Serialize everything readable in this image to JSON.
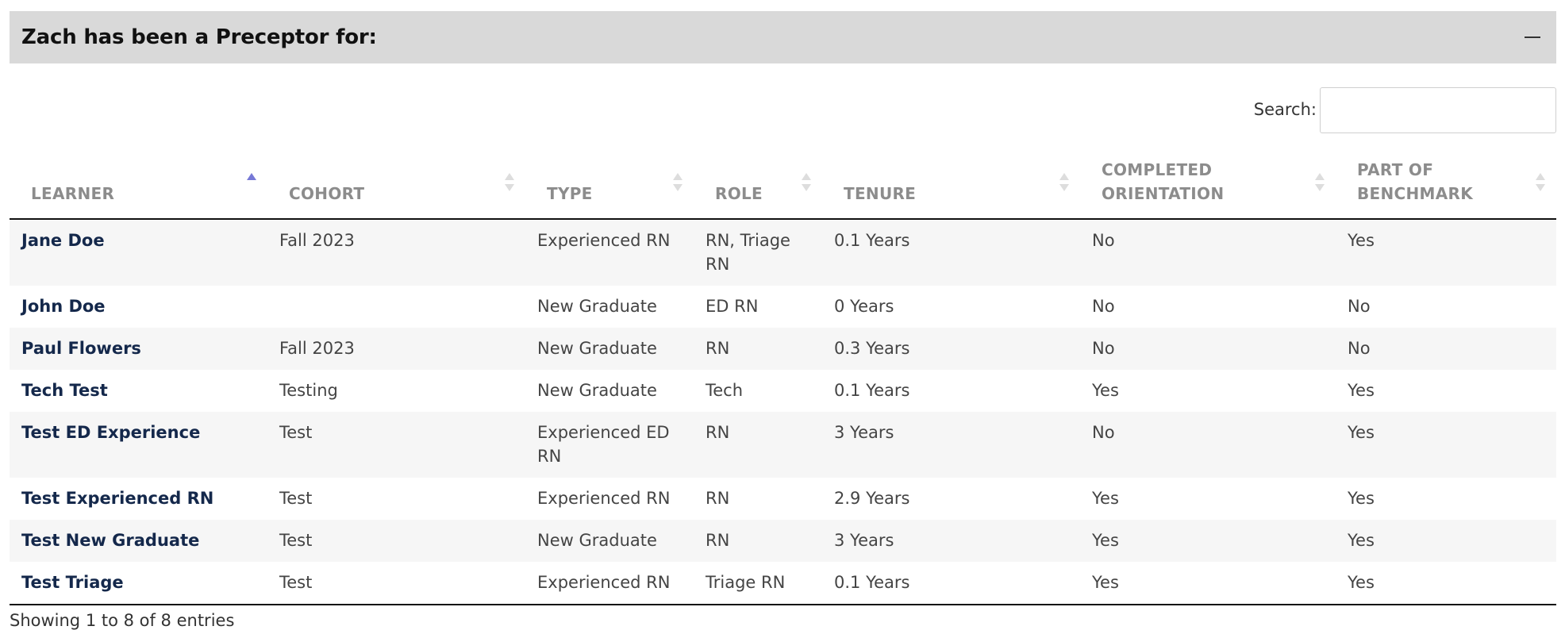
{
  "panel": {
    "title": "Zach has been a Preceptor for:",
    "collapse_icon": "minus-icon"
  },
  "search": {
    "label": "Search:",
    "value": "",
    "placeholder": ""
  },
  "table": {
    "columns": [
      {
        "label": "LEARNER",
        "sort": "asc"
      },
      {
        "label": "COHORT",
        "sort": "none"
      },
      {
        "label": "TYPE",
        "sort": "none"
      },
      {
        "label": "ROLE",
        "sort": "none"
      },
      {
        "label": "TENURE",
        "sort": "none"
      },
      {
        "label": "COMPLETED ORIENTATION",
        "sort": "none"
      },
      {
        "label": "PART OF BENCHMARK",
        "sort": "none"
      }
    ],
    "rows": [
      [
        "Jane Doe",
        "Fall 2023",
        "Experienced RN",
        "RN, Triage RN",
        "0.1 Years",
        "No",
        "Yes"
      ],
      [
        "John Doe",
        "",
        "New Graduate",
        "ED RN",
        "0 Years",
        "No",
        "No"
      ],
      [
        "Paul Flowers",
        "Fall 2023",
        "New Graduate",
        "RN",
        "0.3 Years",
        "No",
        "No"
      ],
      [
        "Tech Test",
        "Testing",
        "New Graduate",
        "Tech",
        "0.1 Years",
        "Yes",
        "Yes"
      ],
      [
        "Test ED Experience",
        "Test",
        "Experienced ED RN",
        "RN",
        "3 Years",
        "No",
        "Yes"
      ],
      [
        "Test Experienced RN",
        "Test",
        "Experienced RN",
        "RN",
        "2.9 Years",
        "Yes",
        "Yes"
      ],
      [
        "Test New Graduate",
        "Test",
        "New Graduate",
        "RN",
        "3 Years",
        "Yes",
        "Yes"
      ],
      [
        "Test Triage",
        "Test",
        "Experienced RN",
        "Triage RN",
        "0.1 Years",
        "Yes",
        "Yes"
      ]
    ]
  },
  "footer": {
    "info": "Showing 1 to 8 of 8 entries"
  },
  "colors": {
    "header_bg": "#d9d9d9",
    "learner_link": "#14284b",
    "sort_active": "#7678d6",
    "column_header_text": "#8c8c8c"
  }
}
